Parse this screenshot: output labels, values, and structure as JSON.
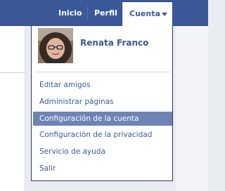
{
  "nav": {
    "inicio": "Inicio",
    "perfil": "Perfil",
    "cuenta": "Cuenta"
  },
  "profile": {
    "name": "Renata Franco"
  },
  "menu": {
    "items": [
      {
        "label": "Editar amigos"
      },
      {
        "label": "Administrar páginas"
      },
      {
        "label": "Configuración de la cuenta"
      },
      {
        "label": "Configuración de la privacidad"
      },
      {
        "label": "Servicio de ayuda"
      },
      {
        "label": "Salir"
      }
    ],
    "active_index": 2
  },
  "colors": {
    "brand_blue": "#3b5998",
    "highlight": "#6d84b4"
  }
}
